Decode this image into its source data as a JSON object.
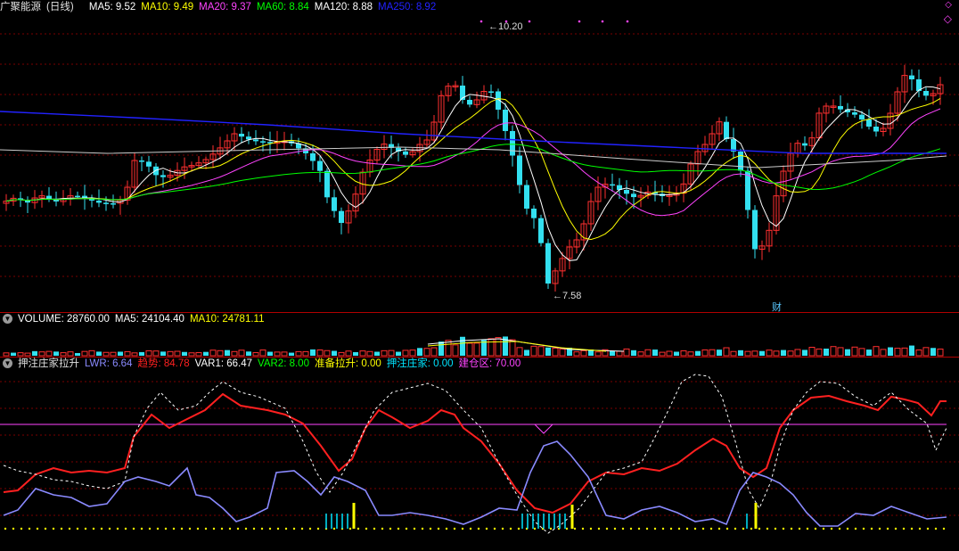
{
  "stock": {
    "name": "广聚能源",
    "period": "(日线)"
  },
  "main_legend": [
    {
      "key": "ma5",
      "label": "MA5: 9.52",
      "color": "#ffffff"
    },
    {
      "key": "ma10",
      "label": "MA10: 9.49",
      "color": "#ffff00"
    },
    {
      "key": "ma20",
      "label": "MA20: 9.37",
      "color": "#ff44ff"
    },
    {
      "key": "ma60",
      "label": "MA60: 8.84",
      "color": "#00ff00"
    },
    {
      "key": "ma120",
      "label": "MA120: 8.88",
      "color": "#ffffff"
    },
    {
      "key": "ma250",
      "label": "MA250: 8.92",
      "color": "#2222ff"
    }
  ],
  "high_marker": "10.20",
  "low_marker": "7.58",
  "cai_marker": "财",
  "volume_legend": [
    {
      "key": "vol",
      "label": "VOLUME: 28760.00",
      "color": "#ffffff"
    },
    {
      "key": "vma5",
      "label": "MA5: 24104.40",
      "color": "#ffffff"
    },
    {
      "key": "vma10",
      "label": "MA10: 24781.11",
      "color": "#ffff00"
    }
  ],
  "indicator_legend": {
    "name": "押注庄家拉升",
    "items": [
      {
        "key": "lwr",
        "label": "LWR: 6.64",
        "color": "#8a8aff"
      },
      {
        "key": "trend",
        "label": "趋势: 84.78",
        "color": "#ff2020"
      },
      {
        "key": "var1",
        "label": "VAR1: 66.47",
        "color": "#ffffff"
      },
      {
        "key": "var2",
        "label": "VAR2: 8.00",
        "color": "#00ff00"
      },
      {
        "key": "prep",
        "label": "准备拉升: 0.00",
        "color": "#ffff00"
      },
      {
        "key": "bet",
        "label": "押注庄家: 0.00",
        "color": "#00e5ff"
      },
      {
        "key": "build",
        "label": "建仓区: 70.00",
        "color": "#ff44ff"
      }
    ]
  },
  "colors": {
    "up": "#ff3030",
    "down": "#33e0f0",
    "grid": "#7a0000"
  }
}
